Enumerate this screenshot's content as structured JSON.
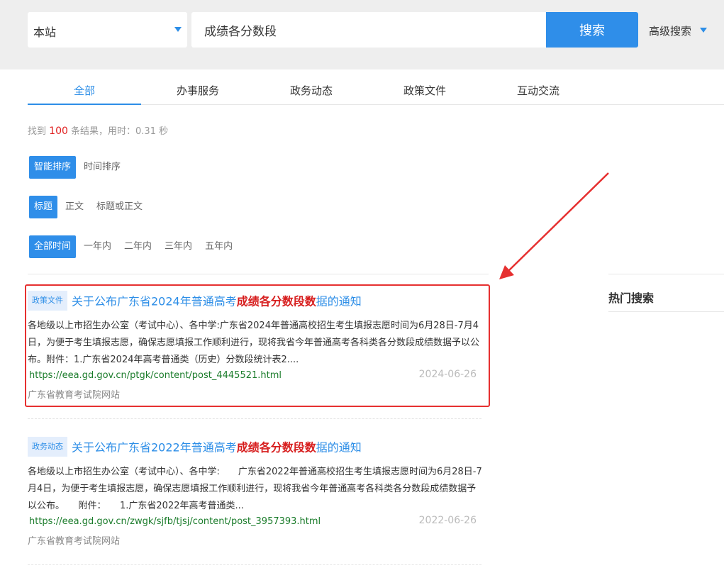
{
  "search": {
    "scope": "本站",
    "query": "成绩各分数段",
    "button": "搜索",
    "advanced": "高级搜索"
  },
  "tabs": [
    "全部",
    "办事服务",
    "政务动态",
    "政策文件",
    "互动交流"
  ],
  "stats": {
    "prefix": "找到",
    "count": "100",
    "suffix": "条结果，用时：0.31 秒"
  },
  "filters": {
    "sort": [
      "智能排序",
      "时间排序"
    ],
    "field": [
      "标题",
      "正文",
      "标题或正文"
    ],
    "time": [
      "全部时间",
      "一年内",
      "二年内",
      "三年内",
      "五年内"
    ]
  },
  "sidebar": {
    "hot_title": "热门搜索"
  },
  "results": [
    {
      "badge": "政策文件",
      "title_pre": "关于公布广东省2024年普通高考",
      "title_hl": "成绩各分数段数",
      "title_post": "据的通知",
      "summary": "各地级以上市招生办公室（考试中心）、各中学:广东省2024年普通高校招生考生填报志愿时间为6月28日-7月4日，为便于考生填报志愿，确保志愿填报工作顺利进行，现将我省今年普通高考各科类各分数段成绩数据予以公布。附件：1.广东省2024年高考普通类（历史）分数段统计表2....",
      "url": "https://eea.gd.gov.cn/ptgk/content/post_4445521.html",
      "date": "2024-06-26",
      "site": "广东省教育考试院网站"
    },
    {
      "badge": "政务动态",
      "title_pre": "关于公布广东省2022年普通高考",
      "title_hl": "成绩各分数段数",
      "title_post": "据的通知",
      "summary": "各地级以上市招生办公室（考试中心）、各中学:　　广东省2022年普通高校招生考生填报志愿时间为6月28日-7月4日，为便于考生填报志愿，确保志愿填报工作顺利进行，现将我省今年普通高考各科类各分数段成绩数据予以公布。　　附件：　　1.广东省2022年高考普通类...",
      "url": "https://eea.gd.gov.cn/zwgk/sjfb/tjsj/content/post_3957393.html",
      "date": "2022-06-26",
      "site": "广东省教育考试院网站"
    }
  ],
  "colors": {
    "accent": "#2f8ee9",
    "highlight": "#d71e1e",
    "annotation": "#e63030",
    "url": "#1b7c2b"
  }
}
